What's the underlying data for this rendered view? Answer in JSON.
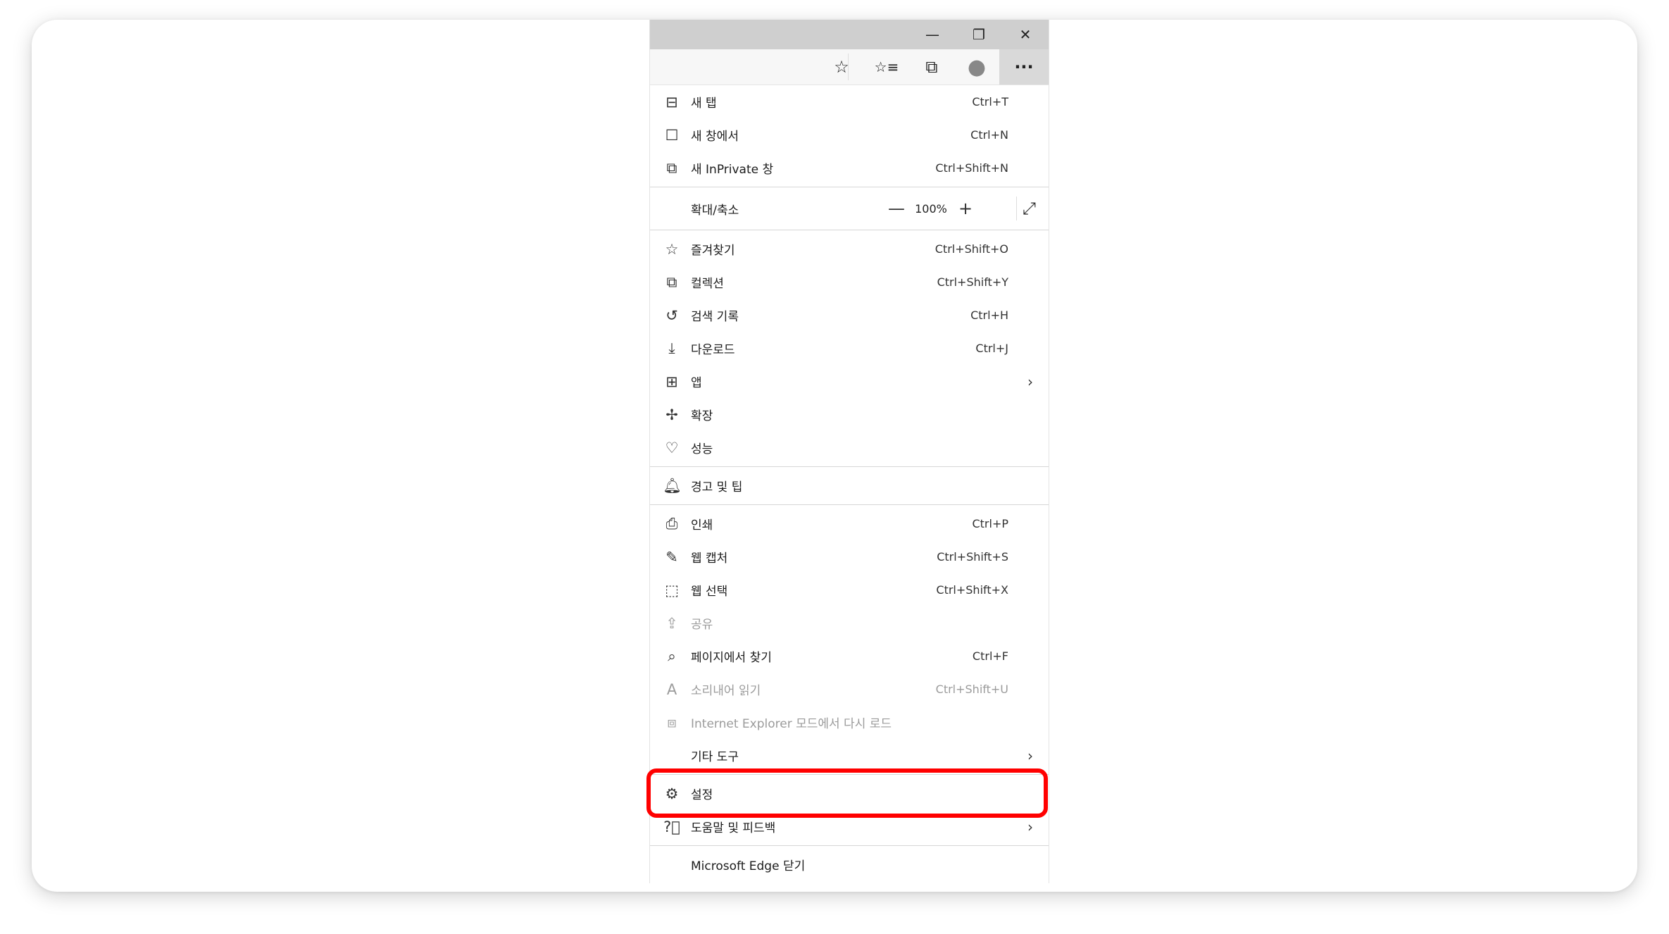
{
  "window": {
    "minimize": "—",
    "restore": "❐",
    "close": "✕"
  },
  "toolbar": {
    "add_favorite_icon": "☆",
    "favorites_icon": "☆≡",
    "collections_icon": "⧉",
    "profile_icon": "●",
    "more_icon": "···"
  },
  "menu": {
    "group1": [
      {
        "label": "새 탭",
        "shortcut": "Ctrl+T",
        "icon": "new-tab-icon"
      },
      {
        "label": "새 창에서",
        "shortcut": "Ctrl+N",
        "icon": "new-window-icon"
      },
      {
        "label": "새 InPrivate 창",
        "shortcut": "Ctrl+Shift+N",
        "icon": "inprivate-icon"
      }
    ],
    "zoom": {
      "label": "확대/축소",
      "value": "100%",
      "minus": "—",
      "plus": "+",
      "fullscreen": "⤢"
    },
    "group2": [
      {
        "label": "즐겨찾기",
        "shortcut": "Ctrl+Shift+O",
        "icon": "favorites-icon"
      },
      {
        "label": "컬렉션",
        "shortcut": "Ctrl+Shift+Y",
        "icon": "collections-icon"
      },
      {
        "label": "검색 기록",
        "shortcut": "Ctrl+H",
        "icon": "history-icon"
      },
      {
        "label": "다운로드",
        "shortcut": "Ctrl+J",
        "icon": "download-icon"
      },
      {
        "label": "앱",
        "shortcut": "",
        "icon": "apps-icon",
        "submenu": true
      },
      {
        "label": "확장",
        "shortcut": "",
        "icon": "extensions-icon"
      },
      {
        "label": "성능",
        "shortcut": "",
        "icon": "performance-icon"
      }
    ],
    "group3": [
      {
        "label": "경고 및 팁",
        "icon": "bell-icon"
      }
    ],
    "group4": [
      {
        "label": "인쇄",
        "shortcut": "Ctrl+P",
        "icon": "print-icon"
      },
      {
        "label": "웹 캡처",
        "shortcut": "Ctrl+Shift+S",
        "icon": "web-capture-icon"
      },
      {
        "label": "웹 선택",
        "shortcut": "Ctrl+Shift+X",
        "icon": "web-select-icon"
      },
      {
        "label": "공유",
        "shortcut": "",
        "icon": "share-icon",
        "disabled": true
      },
      {
        "label": "페이지에서 찾기",
        "shortcut": "Ctrl+F",
        "icon": "find-icon"
      },
      {
        "label": "소리내어 읽기",
        "shortcut": "Ctrl+Shift+U",
        "icon": "read-aloud-icon",
        "disabled": true
      },
      {
        "label": "Internet Explorer 모드에서 다시 로드",
        "shortcut": "",
        "icon": "ie-mode-icon",
        "disabled": true
      },
      {
        "label": "기타 도구",
        "shortcut": "",
        "icon": "",
        "submenu": true
      }
    ],
    "group5": [
      {
        "label": "설정",
        "icon": "gear-icon"
      },
      {
        "label": "도움말 및 피드백",
        "icon": "help-icon",
        "submenu": true
      }
    ],
    "close": {
      "label": "Microsoft Edge 닫기"
    }
  },
  "colors": {
    "highlight": "#ff0000",
    "titlebar": "#cfcfcf"
  }
}
